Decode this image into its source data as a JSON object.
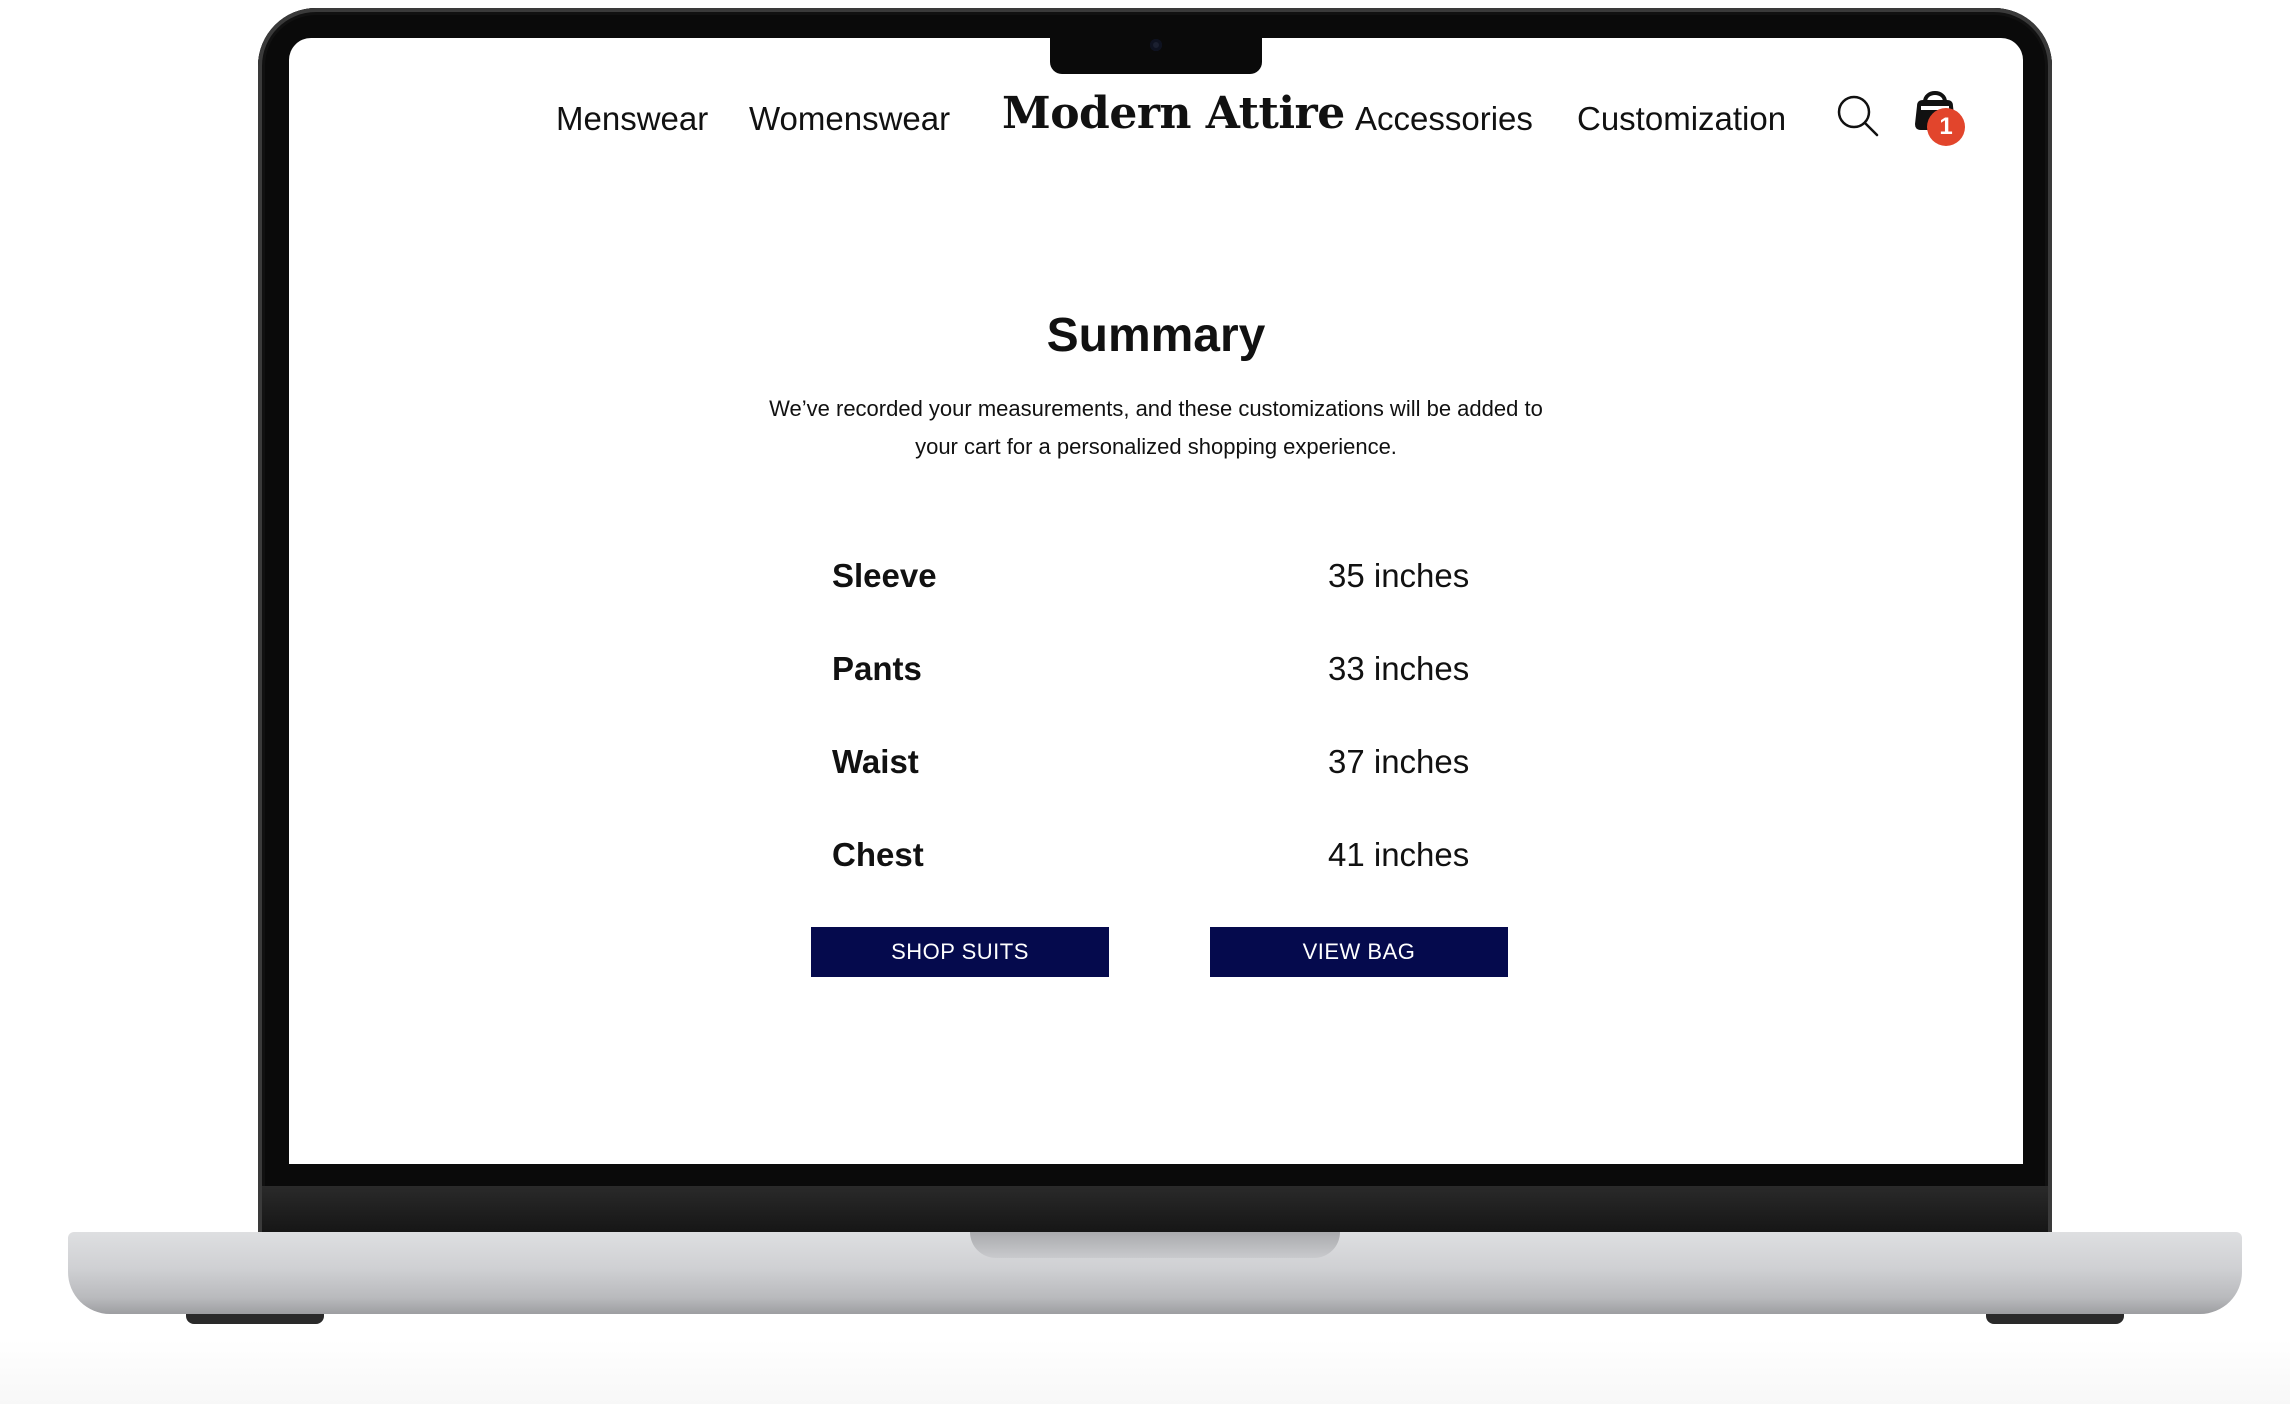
{
  "nav": {
    "left_links": [
      "Menswear",
      "Womenswear"
    ],
    "brand": "Modern Attire",
    "right_links": [
      "Accessories",
      "Customization"
    ],
    "search_icon": "search-icon",
    "cart_icon": "shopping-bag-icon",
    "cart_count": "1",
    "cart_badge_color": "#e2452c"
  },
  "summary": {
    "title": "Summary",
    "description": "We’ve recorded your measurements, and these customizations will be added to your cart for a personalized shopping experience."
  },
  "measurements": [
    {
      "label": "Sleeve",
      "value": "35 inches"
    },
    {
      "label": "Pants",
      "value": "33 inches"
    },
    {
      "label": "Waist",
      "value": "37 inches"
    },
    {
      "label": "Chest",
      "value": "41 inches"
    }
  ],
  "actions": {
    "shop_suits": "SHOP SUITS",
    "view_bag": "VIEW BAG",
    "button_color": "#050a4d"
  }
}
